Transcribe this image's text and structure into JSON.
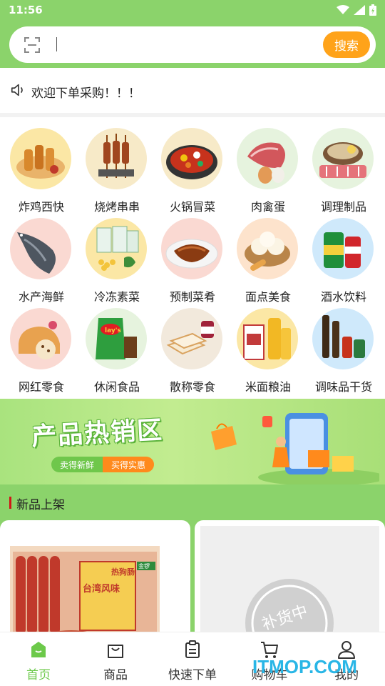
{
  "status_bar": {
    "time": "11:56"
  },
  "search": {
    "placeholder": "",
    "button_label": "搜索"
  },
  "notice": {
    "text": "欢迎下单采购！！！"
  },
  "categories": [
    {
      "label": "炸鸡西快",
      "icon": "fried-chicken"
    },
    {
      "label": "烧烤串串",
      "icon": "bbq-skewers"
    },
    {
      "label": "火锅冒菜",
      "icon": "hot-pot"
    },
    {
      "label": "肉禽蛋",
      "icon": "meat-eggs"
    },
    {
      "label": "调理制品",
      "icon": "prepared-meats"
    },
    {
      "label": "水产海鲜",
      "icon": "fish"
    },
    {
      "label": "冷冻素菜",
      "icon": "frozen-vegetables"
    },
    {
      "label": "预制菜肴",
      "icon": "prepared-dish"
    },
    {
      "label": "面点美食",
      "icon": "steamed-buns"
    },
    {
      "label": "酒水饮料",
      "icon": "drinks"
    },
    {
      "label": "网红零食",
      "icon": "cake-snack"
    },
    {
      "label": "休闲食品",
      "icon": "chips"
    },
    {
      "label": "散称零食",
      "icon": "bread"
    },
    {
      "label": "米面粮油",
      "icon": "rice-oil"
    },
    {
      "label": "调味品干货",
      "icon": "condiments"
    }
  ],
  "banner": {
    "title": "产品热销区",
    "tag_left": "卖得新鲜",
    "tag_right": "买得实惠"
  },
  "new_products": {
    "title": "新品上架",
    "items": [
      {
        "name_lines": [
          "台湾风味",
          "热狗肠"
        ],
        "brand": "金锣"
      },
      {
        "stamp": "补货中"
      }
    ]
  },
  "tabbar": [
    {
      "label": "首页",
      "icon": "home-icon",
      "active": true
    },
    {
      "label": "商品",
      "icon": "bag-icon",
      "active": false
    },
    {
      "label": "快速下单",
      "icon": "clipboard-icon",
      "active": false
    },
    {
      "label": "购物车",
      "icon": "cart-icon",
      "active": false
    },
    {
      "label": "我的",
      "icon": "user-icon",
      "active": false
    }
  ],
  "watermark": "ITMOP.COM",
  "colors": {
    "brand_green": "#8bd36b",
    "accent_orange": "#ffa31a",
    "active_tab": "#6cc94a"
  }
}
